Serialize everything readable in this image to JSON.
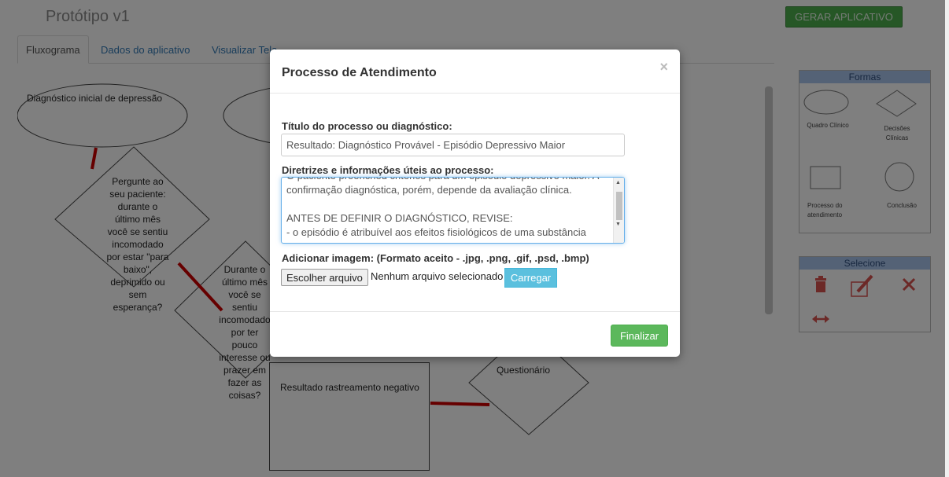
{
  "app": {
    "title": "Protótipo v1",
    "generate_button": "GERAR APLICATIVO"
  },
  "tabs": [
    {
      "label": "Fluxograma"
    },
    {
      "label": "Dados do aplicativo"
    },
    {
      "label": "Visualizar Tela"
    }
  ],
  "flowchart": {
    "node1": "Diagnóstico inicial de depressão",
    "node2": "Pergunte ao seu paciente: durante o último mês você se sentiu incomodado por estar \"para baixo\", deprimido ou sem esperança?",
    "node3": "Durante o último mês você se sentiu incomodado por ter pouco interesse ou prazer em fazer as coisas?",
    "node4": "Resultado rastreamento negativo",
    "node5": "Questionário"
  },
  "shapes_panel": {
    "title": "Formas",
    "items": [
      {
        "label": "Quadro Clínico",
        "icon": "ellipse-icon"
      },
      {
        "label": "Decisões Clínicas",
        "icon": "diamond-icon"
      },
      {
        "label": "Processo do atendimento",
        "icon": "rectangle-icon"
      },
      {
        "label": "Conclusão",
        "icon": "circle-icon"
      }
    ]
  },
  "select_panel": {
    "title": "Selecione",
    "icons": [
      "trash-icon",
      "edit-icon",
      "expand-icon",
      "resize-horizontal-icon"
    ]
  },
  "modal": {
    "title": "Processo de Atendimento",
    "close": "×",
    "title_field_label": "Título do processo ou diagnóstico:",
    "title_field_value": "Resultado: Diagnóstico Provável - Episódio Depressivo Maior",
    "guidelines_label": "Diretrizes e informações úteis ao processo:",
    "guidelines_value": "O paciente preencheu critérios para um episódio depressivo maior. A confirmação diagnóstica, porém, depende da avaliação clínica.\n\nANTES DE DEFINIR O DIAGNÓSTICO, REVISE:\n- o episódio é atribuível aos efeitos fisiológicos de uma substância",
    "image_label": "Adicionar imagem: (Formato aceito - .jpg, .png, .gif, .psd, .bmp)",
    "choose_file": "Escolher arquivo",
    "file_status": "Nenhum arquivo selecionado",
    "upload_button": "Carregar",
    "finish_button": "Finalizar"
  },
  "colors": {
    "accent_green": "#5cb85c",
    "accent_blue": "#5bc0de",
    "link_blue": "#337ab7",
    "connector_red": "#cc0000",
    "icon_red": "#d9534f"
  }
}
